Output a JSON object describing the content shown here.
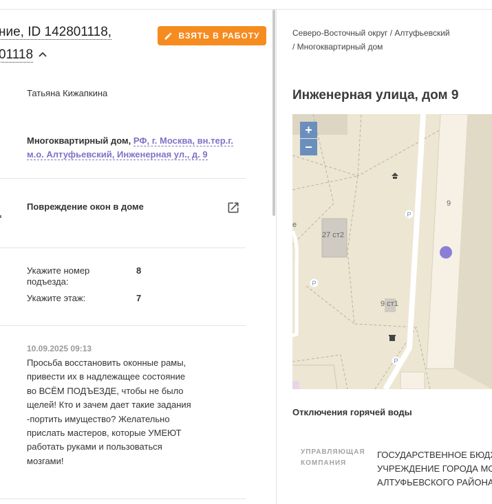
{
  "ticket": {
    "title_line1_visible": "ние, ID 142801118,",
    "title_line2_visible": "01118"
  },
  "actions": {
    "take_to_work_label": "ВЗЯТЬ В РАБОТУ"
  },
  "assignee": {
    "name": "Татьяна Кижапкина"
  },
  "object": {
    "type_label": "Многоквартирный дом,",
    "address_link": "РФ, г. Москва, вн.тер.г. м.о. Алтуфьевский, Инженерная ул., д. 9"
  },
  "problem": {
    "title": "Повреждение окон в доме"
  },
  "fields": [
    {
      "label": "Укажите номер подъезда:",
      "value": "8"
    },
    {
      "label": "Укажите этаж:",
      "value": "7"
    }
  ],
  "comment": {
    "datetime": "10.09.2025 09:13",
    "text": "Просьба восстановить оконные рамы, привести их в надлежащее состояние во ВСЁМ ПОДЪЕЗДЕ, чтобы не было щелей! Кто и зачем дает такие задания -портить имущество? Желательно прислать мастеров, которые УМЕЮТ работать руками и пользоваться мозгами!"
  },
  "location": {
    "breadcrumb": "Северо-Восточный округ / Алтуфьевский / Многоквартирный дом",
    "title": "Инженерная улица, дом 9"
  },
  "map": {
    "zoom_in": "+",
    "zoom_out": "−",
    "labels": {
      "building_9": "9",
      "building_27": "27 ст2",
      "building_9_1": "9 ст1",
      "left_edge": "е"
    },
    "marker_color": "#8a7fd6",
    "parking_icon_label": "P"
  },
  "hot_water": {
    "title": "Отключения горячей воды"
  },
  "management": {
    "label": "УПРАВЛЯЮЩАЯ КОМПАНИЯ",
    "value_lines": [
      "ГОСУДАРСТВЕННОЕ БЮДЖ",
      "УЧРЕЖДЕНИЕ ГОРОДА МО",
      "АЛТУФЬЕВСКОГО РАЙОНА"
    ]
  },
  "colors": {
    "accent": "#f68b1f",
    "link": "#7e73c7"
  }
}
